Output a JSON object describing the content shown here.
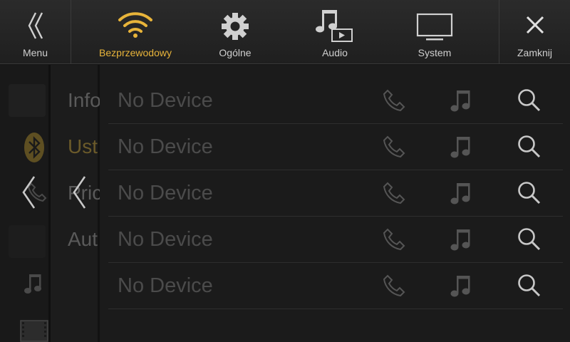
{
  "topbar": {
    "menu": {
      "label": "Menu",
      "icon": "double-chevron-left-icon"
    },
    "tabs": [
      {
        "label": "Bezprzewodowy",
        "icon": "wifi-icon",
        "active": true
      },
      {
        "label": "Ogólne",
        "icon": "gear-icon",
        "active": false
      },
      {
        "label": "Audio",
        "icon": "music-video-icon",
        "active": false
      },
      {
        "label": "System",
        "icon": "monitor-icon",
        "active": false
      }
    ],
    "close": {
      "label": "Zamknij",
      "icon": "close-icon"
    },
    "active_color": "#e8b43a"
  },
  "background_menu": {
    "items": [
      "Info",
      "Ust",
      "Pric",
      "Aut"
    ]
  },
  "devices": [
    {
      "name": "No Device"
    },
    {
      "name": "No Device"
    },
    {
      "name": "No Device"
    },
    {
      "name": "No Device"
    },
    {
      "name": "No Device"
    }
  ]
}
